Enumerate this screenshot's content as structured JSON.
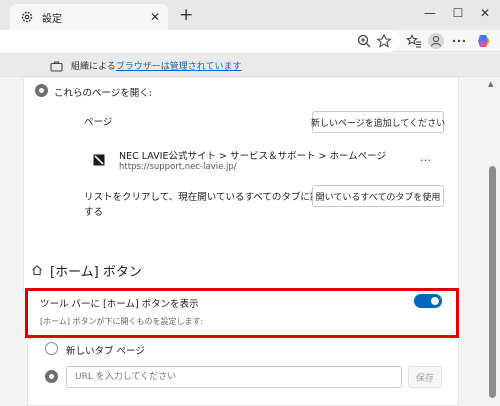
{
  "tab": {
    "title": "設定",
    "close": "✕",
    "new_tab": "+"
  },
  "window": {
    "minimize": "—",
    "maximize": "☐",
    "close": "✕"
  },
  "managed_bar": {
    "prefix": "組織による",
    "link": "ブラウザーは管理されています"
  },
  "startup": {
    "open_pages_label": "これらのページを開く:",
    "pages_header": "ページ",
    "add_page_button": "新しいページを追加してください",
    "page_title": "NEC LAVIE公式サイト > サービス＆サポート > ホームページ",
    "page_url": "https://support.nec-lavie.jp/",
    "more_menu": "…",
    "clear_text_line1": "リストをクリアして、現在開いているすべてのタブに設定",
    "clear_text_line2": "する",
    "use_all_tabs_button": "開いているすべてのタブを使用"
  },
  "home_section": {
    "title": "[ホーム] ボタン",
    "toggle_label": "ツール バーに [ホーム] ボタンを表示",
    "toggle_desc": "[ホーム] ボタンが下に開くものを設定します:",
    "toggle_on": true,
    "new_tab_option": "新しいタブ ページ",
    "url_placeholder": "URL を入力してください",
    "save_button": "保存"
  },
  "colors": {
    "accent": "#0067c0",
    "highlight": "#e00000",
    "link": "#0b63c8"
  }
}
